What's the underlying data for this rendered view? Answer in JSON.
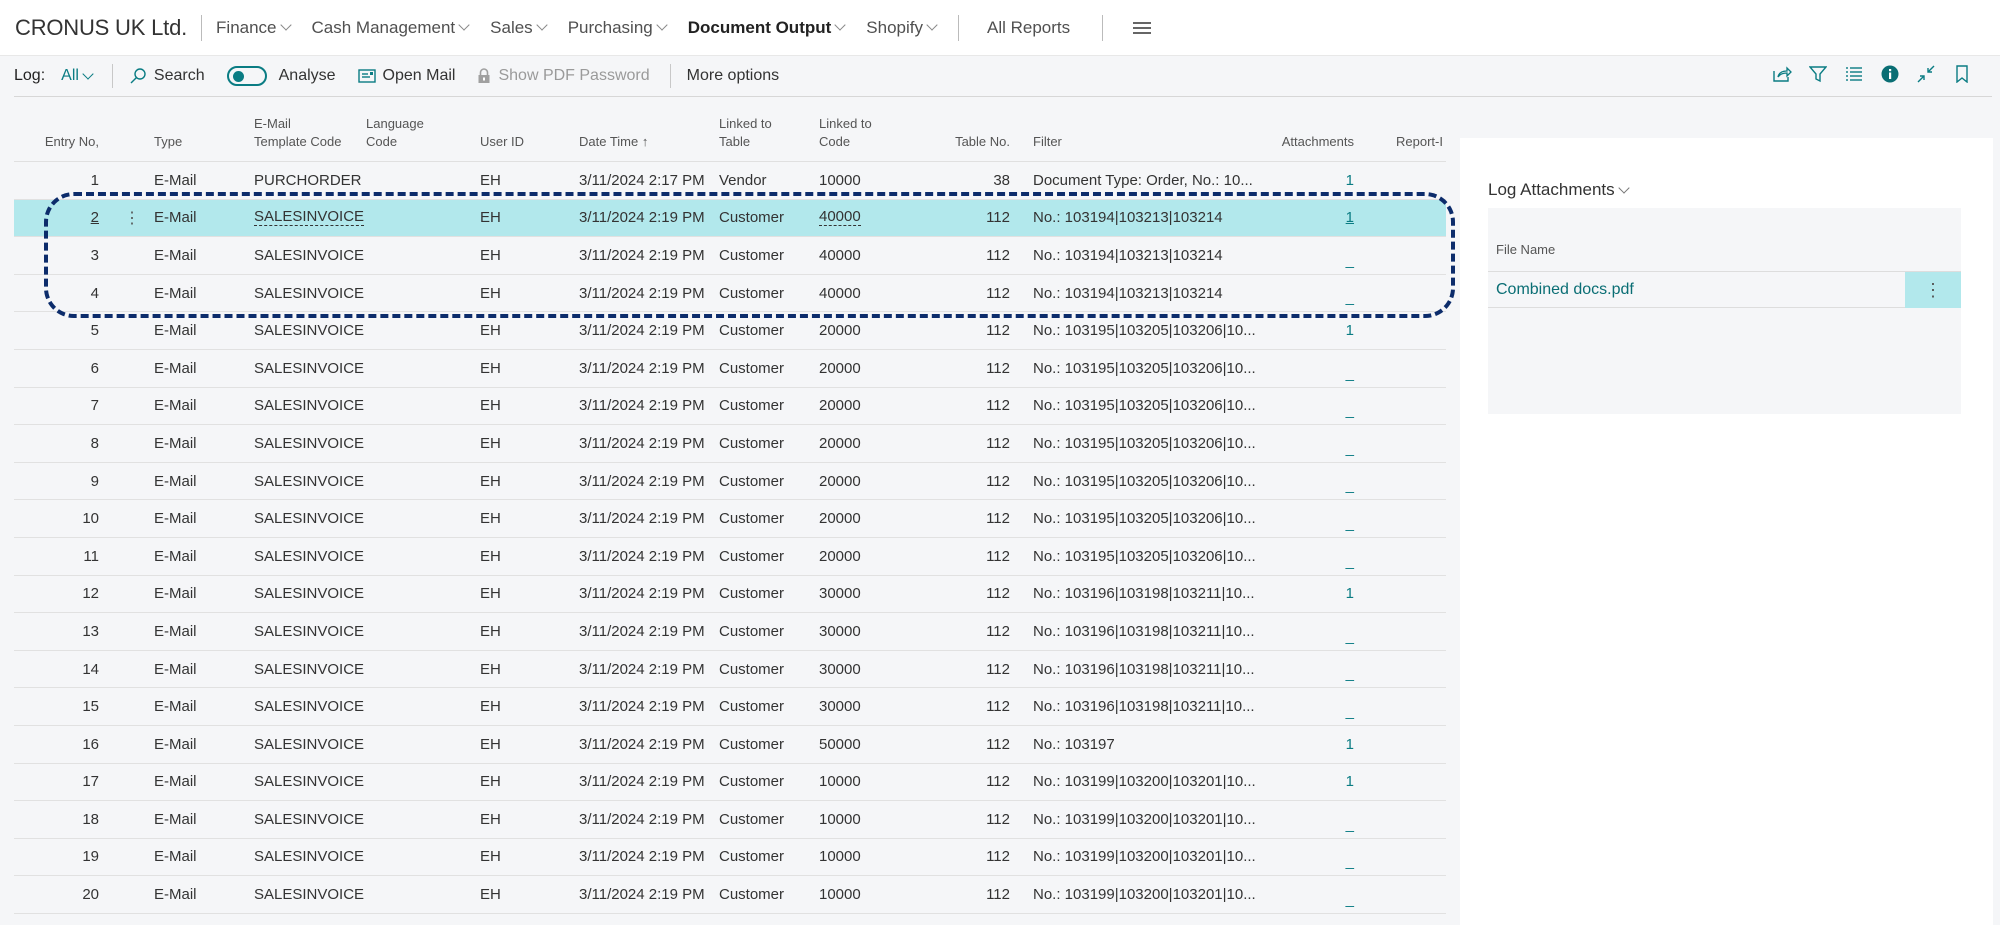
{
  "topnav": {
    "company": "CRONUS UK Ltd.",
    "menus": [
      {
        "label": "Finance",
        "active": false
      },
      {
        "label": "Cash Management",
        "active": false
      },
      {
        "label": "Sales",
        "active": false
      },
      {
        "label": "Purchasing",
        "active": false
      },
      {
        "label": "Document Output",
        "active": true
      },
      {
        "label": "Shopify",
        "active": false
      }
    ],
    "all_reports": "All Reports",
    "menu_icon": "hamburger-icon"
  },
  "toolbar": {
    "log_label": "Log:",
    "log_value": "All",
    "search": "Search",
    "analyse": "Analyse",
    "analyse_on": false,
    "open_mail": "Open Mail",
    "show_pdf_password": "Show PDF Password",
    "more_options": "More options",
    "right_icons": [
      "share-icon",
      "filter-icon",
      "list-view-icon",
      "info-icon",
      "collapse-icon",
      "bookmark-icon"
    ]
  },
  "grid": {
    "columns": [
      {
        "key": "entry_no",
        "label": "Entry No,"
      },
      {
        "key": "type",
        "label": "Type"
      },
      {
        "key": "template",
        "label": "E-Mail\nTemplate Code"
      },
      {
        "key": "language",
        "label": "Language\nCode"
      },
      {
        "key": "user_id",
        "label": "User ID"
      },
      {
        "key": "date_time",
        "label": "Date Time ↑"
      },
      {
        "key": "linked_table",
        "label": "Linked to\nTable"
      },
      {
        "key": "linked_code",
        "label": "Linked to\nCode"
      },
      {
        "key": "table_no",
        "label": "Table No."
      },
      {
        "key": "filter",
        "label": "Filter"
      },
      {
        "key": "attachments",
        "label": "Attachments"
      },
      {
        "key": "report",
        "label": "Report-I"
      }
    ],
    "selected_row": 2,
    "rows": [
      {
        "entry_no": "1",
        "type": "E-Mail",
        "template": "PURCHORDER",
        "language": "",
        "user_id": "EH",
        "date_time": "3/11/2024 2:17 PM",
        "linked_table": "Vendor",
        "linked_code": "10000",
        "table_no": "38",
        "filter": "Document Type: Order, No.: 10...",
        "attachments": "1"
      },
      {
        "entry_no": "2",
        "type": "E-Mail",
        "template": "SALESINVOICE",
        "language": "",
        "user_id": "EH",
        "date_time": "3/11/2024 2:19 PM",
        "linked_table": "Customer",
        "linked_code": "40000",
        "table_no": "112",
        "filter": "No.: 103194|103213|103214",
        "attachments": "1"
      },
      {
        "entry_no": "3",
        "type": "E-Mail",
        "template": "SALESINVOICE",
        "language": "",
        "user_id": "EH",
        "date_time": "3/11/2024 2:19 PM",
        "linked_table": "Customer",
        "linked_code": "40000",
        "table_no": "112",
        "filter": "No.: 103194|103213|103214",
        "attachments": "_"
      },
      {
        "entry_no": "4",
        "type": "E-Mail",
        "template": "SALESINVOICE",
        "language": "",
        "user_id": "EH",
        "date_time": "3/11/2024 2:19 PM",
        "linked_table": "Customer",
        "linked_code": "40000",
        "table_no": "112",
        "filter": "No.: 103194|103213|103214",
        "attachments": "_"
      },
      {
        "entry_no": "5",
        "type": "E-Mail",
        "template": "SALESINVOICE",
        "language": "",
        "user_id": "EH",
        "date_time": "3/11/2024 2:19 PM",
        "linked_table": "Customer",
        "linked_code": "20000",
        "table_no": "112",
        "filter": "No.: 103195|103205|103206|10...",
        "attachments": "1"
      },
      {
        "entry_no": "6",
        "type": "E-Mail",
        "template": "SALESINVOICE",
        "language": "",
        "user_id": "EH",
        "date_time": "3/11/2024 2:19 PM",
        "linked_table": "Customer",
        "linked_code": "20000",
        "table_no": "112",
        "filter": "No.: 103195|103205|103206|10...",
        "attachments": "_"
      },
      {
        "entry_no": "7",
        "type": "E-Mail",
        "template": "SALESINVOICE",
        "language": "",
        "user_id": "EH",
        "date_time": "3/11/2024 2:19 PM",
        "linked_table": "Customer",
        "linked_code": "20000",
        "table_no": "112",
        "filter": "No.: 103195|103205|103206|10...",
        "attachments": "_"
      },
      {
        "entry_no": "8",
        "type": "E-Mail",
        "template": "SALESINVOICE",
        "language": "",
        "user_id": "EH",
        "date_time": "3/11/2024 2:19 PM",
        "linked_table": "Customer",
        "linked_code": "20000",
        "table_no": "112",
        "filter": "No.: 103195|103205|103206|10...",
        "attachments": "_"
      },
      {
        "entry_no": "9",
        "type": "E-Mail",
        "template": "SALESINVOICE",
        "language": "",
        "user_id": "EH",
        "date_time": "3/11/2024 2:19 PM",
        "linked_table": "Customer",
        "linked_code": "20000",
        "table_no": "112",
        "filter": "No.: 103195|103205|103206|10...",
        "attachments": "_"
      },
      {
        "entry_no": "10",
        "type": "E-Mail",
        "template": "SALESINVOICE",
        "language": "",
        "user_id": "EH",
        "date_time": "3/11/2024 2:19 PM",
        "linked_table": "Customer",
        "linked_code": "20000",
        "table_no": "112",
        "filter": "No.: 103195|103205|103206|10...",
        "attachments": "_"
      },
      {
        "entry_no": "11",
        "type": "E-Mail",
        "template": "SALESINVOICE",
        "language": "",
        "user_id": "EH",
        "date_time": "3/11/2024 2:19 PM",
        "linked_table": "Customer",
        "linked_code": "20000",
        "table_no": "112",
        "filter": "No.: 103195|103205|103206|10...",
        "attachments": "_"
      },
      {
        "entry_no": "12",
        "type": "E-Mail",
        "template": "SALESINVOICE",
        "language": "",
        "user_id": "EH",
        "date_time": "3/11/2024 2:19 PM",
        "linked_table": "Customer",
        "linked_code": "30000",
        "table_no": "112",
        "filter": "No.: 103196|103198|103211|10...",
        "attachments": "1"
      },
      {
        "entry_no": "13",
        "type": "E-Mail",
        "template": "SALESINVOICE",
        "language": "",
        "user_id": "EH",
        "date_time": "3/11/2024 2:19 PM",
        "linked_table": "Customer",
        "linked_code": "30000",
        "table_no": "112",
        "filter": "No.: 103196|103198|103211|10...",
        "attachments": "_"
      },
      {
        "entry_no": "14",
        "type": "E-Mail",
        "template": "SALESINVOICE",
        "language": "",
        "user_id": "EH",
        "date_time": "3/11/2024 2:19 PM",
        "linked_table": "Customer",
        "linked_code": "30000",
        "table_no": "112",
        "filter": "No.: 103196|103198|103211|10...",
        "attachments": "_"
      },
      {
        "entry_no": "15",
        "type": "E-Mail",
        "template": "SALESINVOICE",
        "language": "",
        "user_id": "EH",
        "date_time": "3/11/2024 2:19 PM",
        "linked_table": "Customer",
        "linked_code": "30000",
        "table_no": "112",
        "filter": "No.: 103196|103198|103211|10...",
        "attachments": "_"
      },
      {
        "entry_no": "16",
        "type": "E-Mail",
        "template": "SALESINVOICE",
        "language": "",
        "user_id": "EH",
        "date_time": "3/11/2024 2:19 PM",
        "linked_table": "Customer",
        "linked_code": "50000",
        "table_no": "112",
        "filter": "No.: 103197",
        "attachments": "1"
      },
      {
        "entry_no": "17",
        "type": "E-Mail",
        "template": "SALESINVOICE",
        "language": "",
        "user_id": "EH",
        "date_time": "3/11/2024 2:19 PM",
        "linked_table": "Customer",
        "linked_code": "10000",
        "table_no": "112",
        "filter": "No.: 103199|103200|103201|10...",
        "attachments": "1"
      },
      {
        "entry_no": "18",
        "type": "E-Mail",
        "template": "SALESINVOICE",
        "language": "",
        "user_id": "EH",
        "date_time": "3/11/2024 2:19 PM",
        "linked_table": "Customer",
        "linked_code": "10000",
        "table_no": "112",
        "filter": "No.: 103199|103200|103201|10...",
        "attachments": "_"
      },
      {
        "entry_no": "19",
        "type": "E-Mail",
        "template": "SALESINVOICE",
        "language": "",
        "user_id": "EH",
        "date_time": "3/11/2024 2:19 PM",
        "linked_table": "Customer",
        "linked_code": "10000",
        "table_no": "112",
        "filter": "No.: 103199|103200|103201|10...",
        "attachments": "_"
      },
      {
        "entry_no": "20",
        "type": "E-Mail",
        "template": "SALESINVOICE",
        "language": "",
        "user_id": "EH",
        "date_time": "3/11/2024 2:19 PM",
        "linked_table": "Customer",
        "linked_code": "10000",
        "table_no": "112",
        "filter": "No.: 103199|103200|103201|10...",
        "attachments": "_"
      }
    ]
  },
  "factbox": {
    "title": "Log Attachments",
    "column_header": "File Name",
    "files": [
      {
        "name": "Combined docs.pdf"
      }
    ]
  },
  "colors": {
    "accent": "#0a7c83",
    "selected_row": "#b2e8ec",
    "annotation": "#0c2c6b"
  }
}
